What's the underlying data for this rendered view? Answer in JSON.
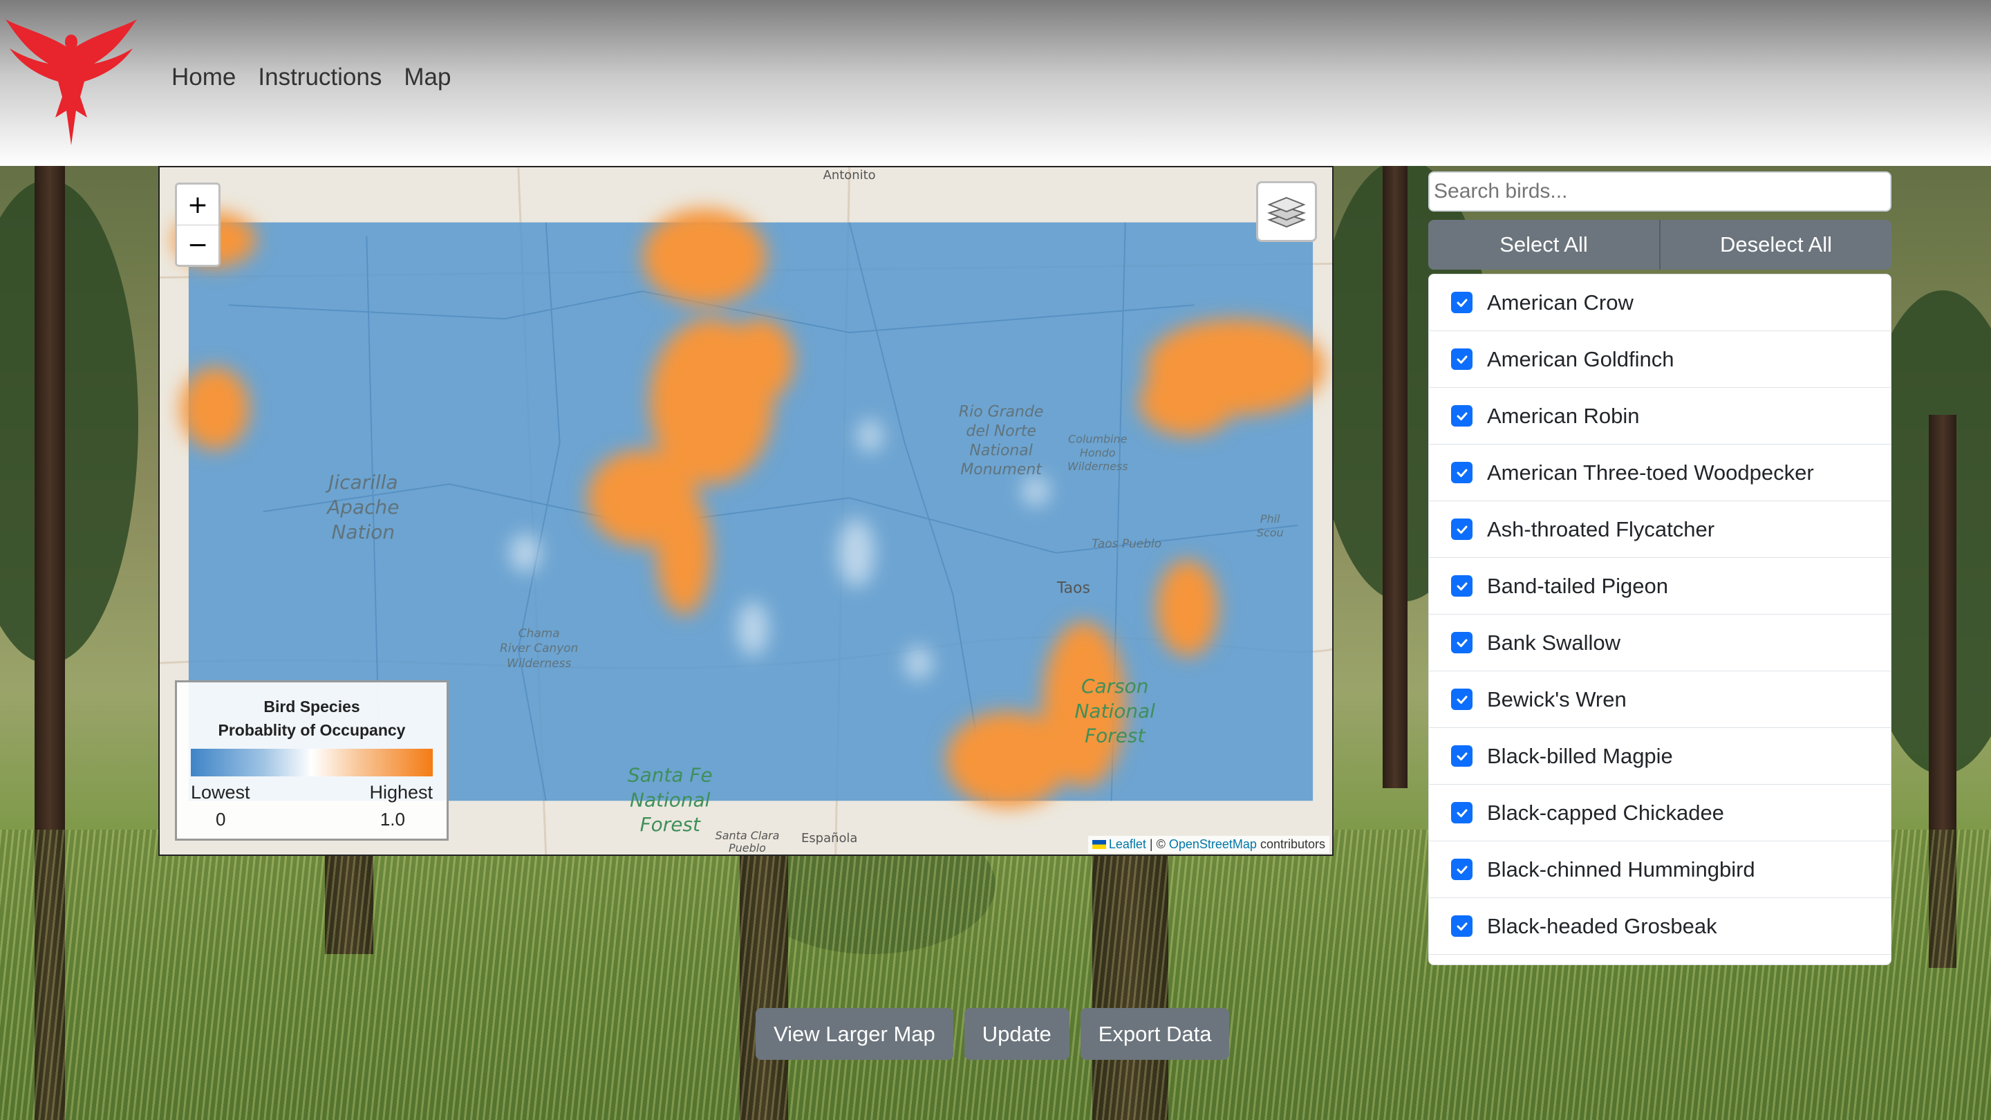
{
  "nav": {
    "logo_alt": "Red phoenix logo",
    "links": [
      "Home",
      "Instructions",
      "Map"
    ]
  },
  "map": {
    "zoom_in": "+",
    "zoom_out": "−",
    "place_labels": [
      "Jicarilla Apache Nation",
      "Rio Grande del Norte National Monument",
      "Columbine Hondo Wilderness",
      "Taos Pueblo",
      "Taos",
      "Chama River Canyon Wilderness",
      "Carson National Forest",
      "Santa Fe National Forest",
      "Santa Clara Pueblo",
      "Española",
      "Antonito"
    ],
    "legend": {
      "title_line1": "Bird Species",
      "title_line2": "Probablity of Occupancy",
      "low_label": "Lowest",
      "high_label": "Highest",
      "low_value": "0",
      "high_value": "1.0",
      "colors": {
        "low": "#3f84c7",
        "mid": "#ffffff",
        "high": "#f47b14"
      }
    },
    "attribution": {
      "leaflet": "Leaflet",
      "separator": "| ©",
      "osm": "OpenStreetMap",
      "suffix": "contributors"
    }
  },
  "panel": {
    "search_placeholder": "Search birds...",
    "select_all": "Select All",
    "deselect_all": "Deselect All",
    "birds": [
      {
        "name": "American Crow",
        "checked": true
      },
      {
        "name": "American Goldfinch",
        "checked": true
      },
      {
        "name": "American Robin",
        "checked": true
      },
      {
        "name": "American Three-toed Woodpecker",
        "checked": true
      },
      {
        "name": "Ash-throated Flycatcher",
        "checked": true
      },
      {
        "name": "Band-tailed Pigeon",
        "checked": true
      },
      {
        "name": "Bank Swallow",
        "checked": true
      },
      {
        "name": "Bewick's Wren",
        "checked": true
      },
      {
        "name": "Black-billed Magpie",
        "checked": true
      },
      {
        "name": "Black-capped Chickadee",
        "checked": true
      },
      {
        "name": "Black-chinned Hummingbird",
        "checked": true
      },
      {
        "name": "Black-headed Grosbeak",
        "checked": true
      }
    ]
  },
  "actions": {
    "larger_map": "View Larger Map",
    "update": "Update",
    "export": "Export Data"
  },
  "colors": {
    "accent": "#0d6efd",
    "button_gray": "#6c757d",
    "heat_blue": "#5b9acf",
    "heat_orange": "#f6953a",
    "logo_red": "#e8242c"
  }
}
